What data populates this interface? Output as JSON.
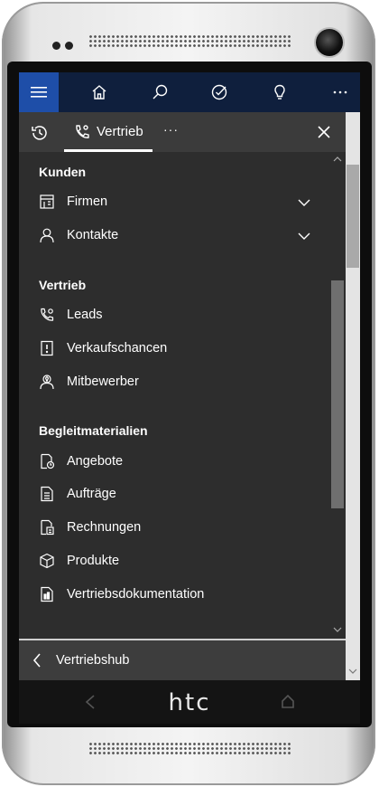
{
  "device": {
    "brand_logo": "htc"
  },
  "navbar": {
    "icons": [
      "hamburger-menu-icon",
      "home-icon",
      "search-icon",
      "activity-check-icon",
      "lightbulb-icon",
      "more-icon"
    ],
    "accent_color": "#1e4ea8",
    "background_color": "#0f1f3d"
  },
  "tabs": {
    "recent_icon": "history-icon",
    "active_tab_label": "Vertrieb",
    "more_label": "···"
  },
  "sections": [
    {
      "title": "Kunden",
      "items": [
        {
          "label": "Firmen",
          "icon": "building-icon",
          "expandable": true
        },
        {
          "label": "Kontakte",
          "icon": "person-icon",
          "expandable": true
        }
      ]
    },
    {
      "title": "Vertrieb",
      "items": [
        {
          "label": "Leads",
          "icon": "phone-gear-icon"
        },
        {
          "label": "Verkaufschancen",
          "icon": "opportunity-icon"
        },
        {
          "label": "Mitbewerber",
          "icon": "competitor-icon"
        }
      ]
    },
    {
      "title": "Begleitmaterialien",
      "items": [
        {
          "label": "Angebote",
          "icon": "quote-icon"
        },
        {
          "label": "Aufträge",
          "icon": "order-icon"
        },
        {
          "label": "Rechnungen",
          "icon": "invoice-icon"
        },
        {
          "label": "Produkte",
          "icon": "product-box-icon"
        },
        {
          "label": "Vertriebsdokumentation",
          "icon": "sales-doc-icon"
        }
      ]
    }
  ],
  "footer": {
    "label": "Vertriebshub"
  }
}
